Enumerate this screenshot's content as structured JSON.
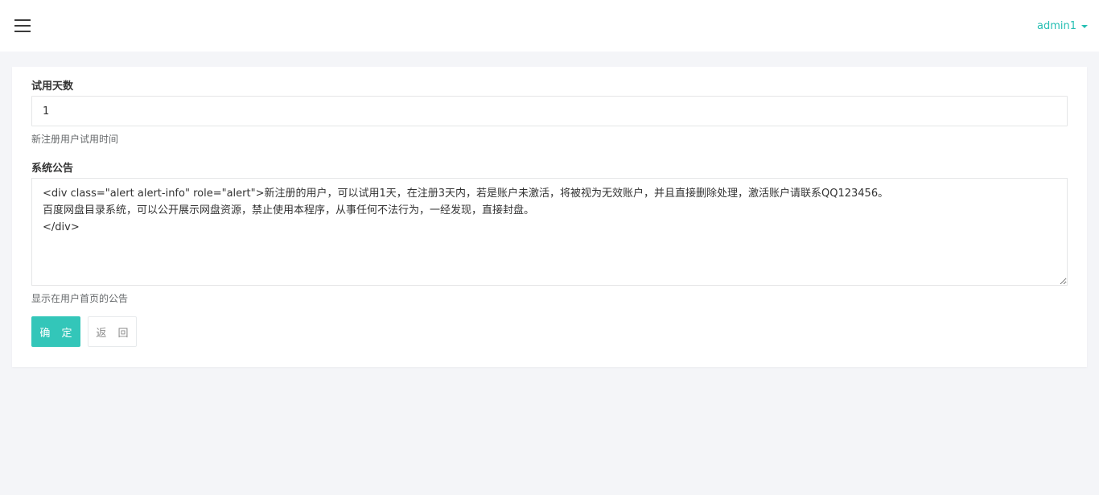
{
  "header": {
    "menu_icon": "hamburger-menu-icon",
    "username": "admin1",
    "dropdown_icon": "caret-down-icon",
    "accent_color": "#26bfb3"
  },
  "form": {
    "trial_days": {
      "label": "试用天数",
      "value": "1",
      "help": "新注册用户试用时间"
    },
    "system_notice": {
      "label": "系统公告",
      "value": "<div class=\"alert alert-info\" role=\"alert\">新注册的用户，可以试用1天，在注册3天内，若是账户未激活，将被视为无效账户，并且直接删除处理，激活账户请联系QQ123456。\n百度网盘目录系统，可以公开展示网盘资源，禁止使用本程序，从事任何不法行为，一经发现，直接封盘。\n</div>",
      "help": "显示在用户首页的公告"
    },
    "buttons": {
      "confirm": "确 定",
      "back": "返 回"
    },
    "confirm_color": "#33c6b9"
  }
}
